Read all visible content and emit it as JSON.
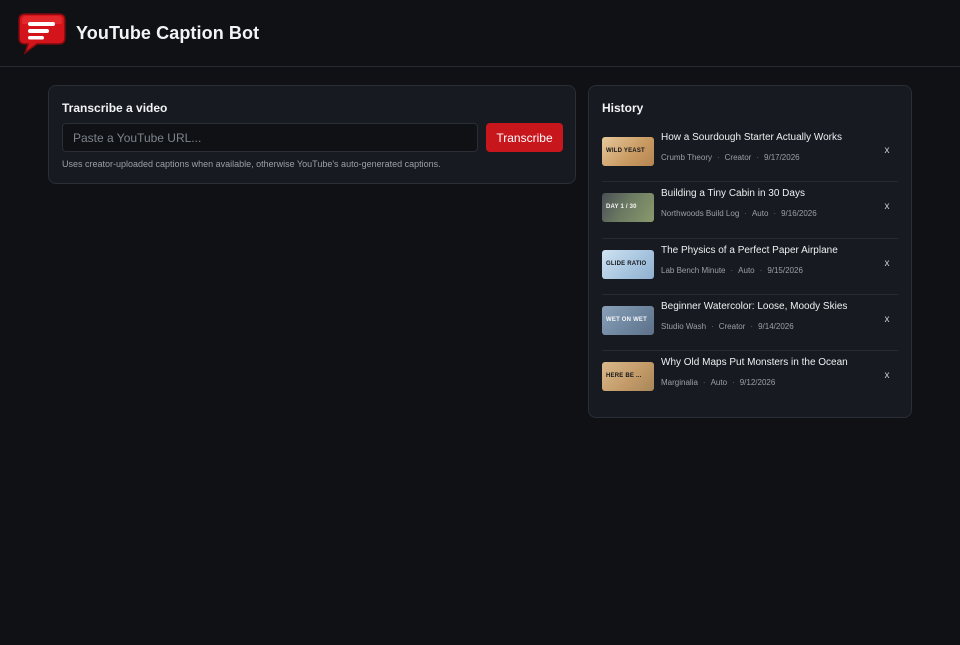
{
  "app": {
    "title": "YouTube Caption Bot"
  },
  "transcribe": {
    "heading": "Transcribe a video",
    "url_placeholder": "Paste a YouTube URL...",
    "url_value": "",
    "button_label": "Transcribe",
    "hint": "Uses creator-uploaded captions when available, otherwise YouTube's auto-generated captions."
  },
  "history": {
    "heading": "History",
    "remove_label": "x",
    "items": [
      {
        "title": "How a Sourdough Starter Actually Works",
        "channel": "Crumb Theory",
        "source": "Creator",
        "date": "9/17/2026",
        "thumb_text": "WILD YEAST"
      },
      {
        "title": "Building a Tiny Cabin in 30 Days",
        "channel": "Northwoods Build Log",
        "source": "Auto",
        "date": "9/16/2026",
        "thumb_text": "DAY 1 / 30"
      },
      {
        "title": "The Physics of a Perfect Paper Airplane",
        "channel": "Lab Bench Minute",
        "source": "Auto",
        "date": "9/15/2026",
        "thumb_text": "GLIDE RATIO"
      },
      {
        "title": "Beginner Watercolor: Loose, Moody Skies",
        "channel": "Studio Wash",
        "source": "Creator",
        "date": "9/14/2026",
        "thumb_text": "WET ON WET"
      },
      {
        "title": "Why Old Maps Put Monsters in the Ocean",
        "channel": "Marginalia",
        "source": "Auto",
        "date": "9/12/2026",
        "thumb_text": "HERE BE ..."
      }
    ]
  },
  "colors": {
    "background": "#0f1115",
    "card": "#171a20",
    "accent": "#c8161d",
    "muted_text": "#9aa0a8"
  },
  "icons": {
    "logo": "red-speech-bubble-caption-icon",
    "remove": "close-icon"
  }
}
